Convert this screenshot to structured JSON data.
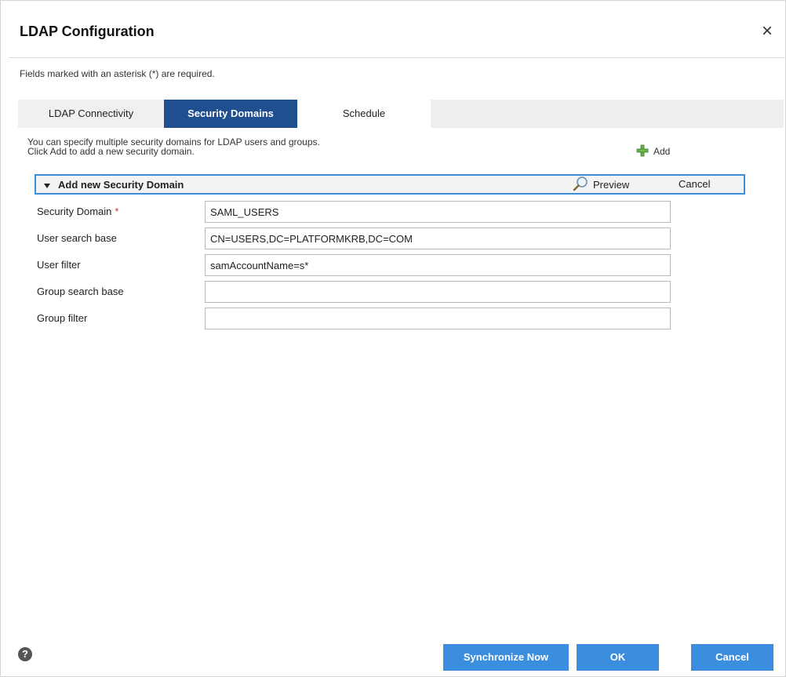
{
  "dialog": {
    "title": "LDAP Configuration",
    "close_glyph": "×",
    "required_note": "Fields marked with an asterisk (*) are required."
  },
  "tabs": [
    {
      "label": "LDAP Connectivity",
      "active": false
    },
    {
      "label": "Security Domains",
      "active": true
    },
    {
      "label": "Schedule",
      "active": false
    }
  ],
  "info": {
    "line1": "You can specify multiple security domains for LDAP users and groups.",
    "line2": "Click Add to add a new security domain."
  },
  "add_button": {
    "label": "Add",
    "icon": "plus-icon"
  },
  "section": {
    "title": "Add new Security Domain",
    "preview_label": "Preview",
    "cancel_label": "Cancel"
  },
  "fields": [
    {
      "label": "Security Domain",
      "required": "*",
      "value": "SAML_USERS"
    },
    {
      "label": "User search base",
      "value": "CN=USERS,DC=PLATFORMKRB,DC=COM"
    },
    {
      "label": "User filter",
      "value": "samAccountName=s*"
    },
    {
      "label": "Group search base",
      "value": ""
    },
    {
      "label": "Group filter",
      "value": ""
    }
  ],
  "footer": {
    "help_glyph": "?",
    "sync_label": "Synchronize Now",
    "ok_label": "OK",
    "cancel_label": "Cancel"
  },
  "colors": {
    "active_tab": "#1f4f8f",
    "button_blue": "#3b8de0",
    "section_border": "#3a8fd6",
    "required_red": "#d9302a",
    "add_icon_green": "#6ab04c"
  }
}
